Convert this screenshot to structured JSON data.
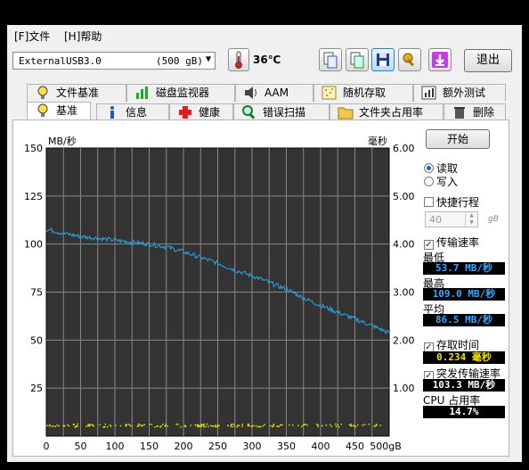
{
  "menu": {
    "file": "[F]文件",
    "help": "[H]帮助"
  },
  "drive": {
    "name": "ExternalUSB3.0",
    "size": "(500 gB)"
  },
  "temperature": "36℃",
  "exit_label": "退出",
  "tabs_row1": [
    "文件基准",
    "磁盘监视器",
    "AAM",
    "随机存取",
    "额外测试"
  ],
  "tabs_row2": [
    "基准",
    "信息",
    "健康",
    "错误扫描",
    "文件夹占用率",
    "删除"
  ],
  "start_label": "开始",
  "mode": {
    "read": "读取",
    "write": "写入",
    "selected": "read"
  },
  "short_stroke": {
    "label": "快捷行程",
    "checked": false,
    "value": "40",
    "unit": "gB"
  },
  "transfer_rate": {
    "label": "传输速率",
    "checked": true
  },
  "stats": {
    "min_label": "最低",
    "min": "53.7 MB/秒",
    "max_label": "最高",
    "max": "109.0 MB/秒",
    "avg_label": "平均",
    "avg": "86.5 MB/秒"
  },
  "access_time": {
    "label": "存取时间",
    "checked": true,
    "value": "0.234 毫秒"
  },
  "burst_rate": {
    "label": "突发传输速率",
    "checked": true,
    "value": "103.3 MB/秒"
  },
  "cpu": {
    "label": "CPU 占用率",
    "value": "14.7%"
  },
  "colors": {
    "transfer": "#2aa4e8",
    "access": "#e8e000",
    "plot_bg": "#333333",
    "grid": "#888888"
  },
  "chart_data": {
    "type": "line",
    "left_axis_label": "MB/秒",
    "right_axis_label": "毫秒",
    "x_ticks": [
      "0",
      "50",
      "100",
      "150",
      "200",
      "250",
      "300",
      "350",
      "400",
      "450",
      "500gB"
    ],
    "y_left_ticks": [
      "150",
      "125",
      "100",
      "75",
      "50",
      "25"
    ],
    "y_right_ticks": [
      "6.00",
      "5.00",
      "4.00",
      "3.00",
      "2.00",
      "1.00"
    ],
    "xlim": [
      0,
      500
    ],
    "ylim_left": [
      0,
      150
    ],
    "ylim_right": [
      0,
      6
    ],
    "series": [
      {
        "name": "传输速率",
        "x": [
          0,
          10,
          25,
          50,
          75,
          100,
          125,
          150,
          175,
          200,
          225,
          250,
          275,
          300,
          325,
          350,
          375,
          400,
          425,
          450,
          475,
          500
        ],
        "values": [
          107.5,
          107,
          105.5,
          104,
          103,
          102,
          101,
          100,
          98.5,
          96,
          93,
          90,
          86.5,
          83.5,
          80,
          76.5,
          72,
          68,
          64.5,
          61,
          57.5,
          53.7
        ]
      },
      {
        "name": "存取时间",
        "x": [
          0,
          500
        ],
        "values": [
          0.234,
          0.234
        ]
      }
    ]
  }
}
